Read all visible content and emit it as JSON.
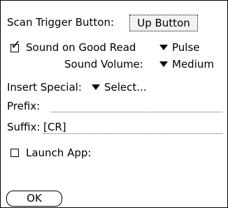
{
  "scan_trigger": {
    "label": "Scan Trigger Button:",
    "value": "Up Button"
  },
  "sound_on_good_read": {
    "label": "Sound on Good Read",
    "checked": true,
    "value": "Pulse"
  },
  "sound_volume": {
    "label": "Sound Volume:",
    "value": "Medium"
  },
  "insert_special": {
    "label": "Insert Special:",
    "value": "Select..."
  },
  "prefix": {
    "label": "Prefix:",
    "value": ""
  },
  "suffix": {
    "label": "Suffix:",
    "value": "[CR]"
  },
  "launch_app": {
    "label": "Launch App:",
    "checked": false
  },
  "ok_button": {
    "label": "OK"
  }
}
